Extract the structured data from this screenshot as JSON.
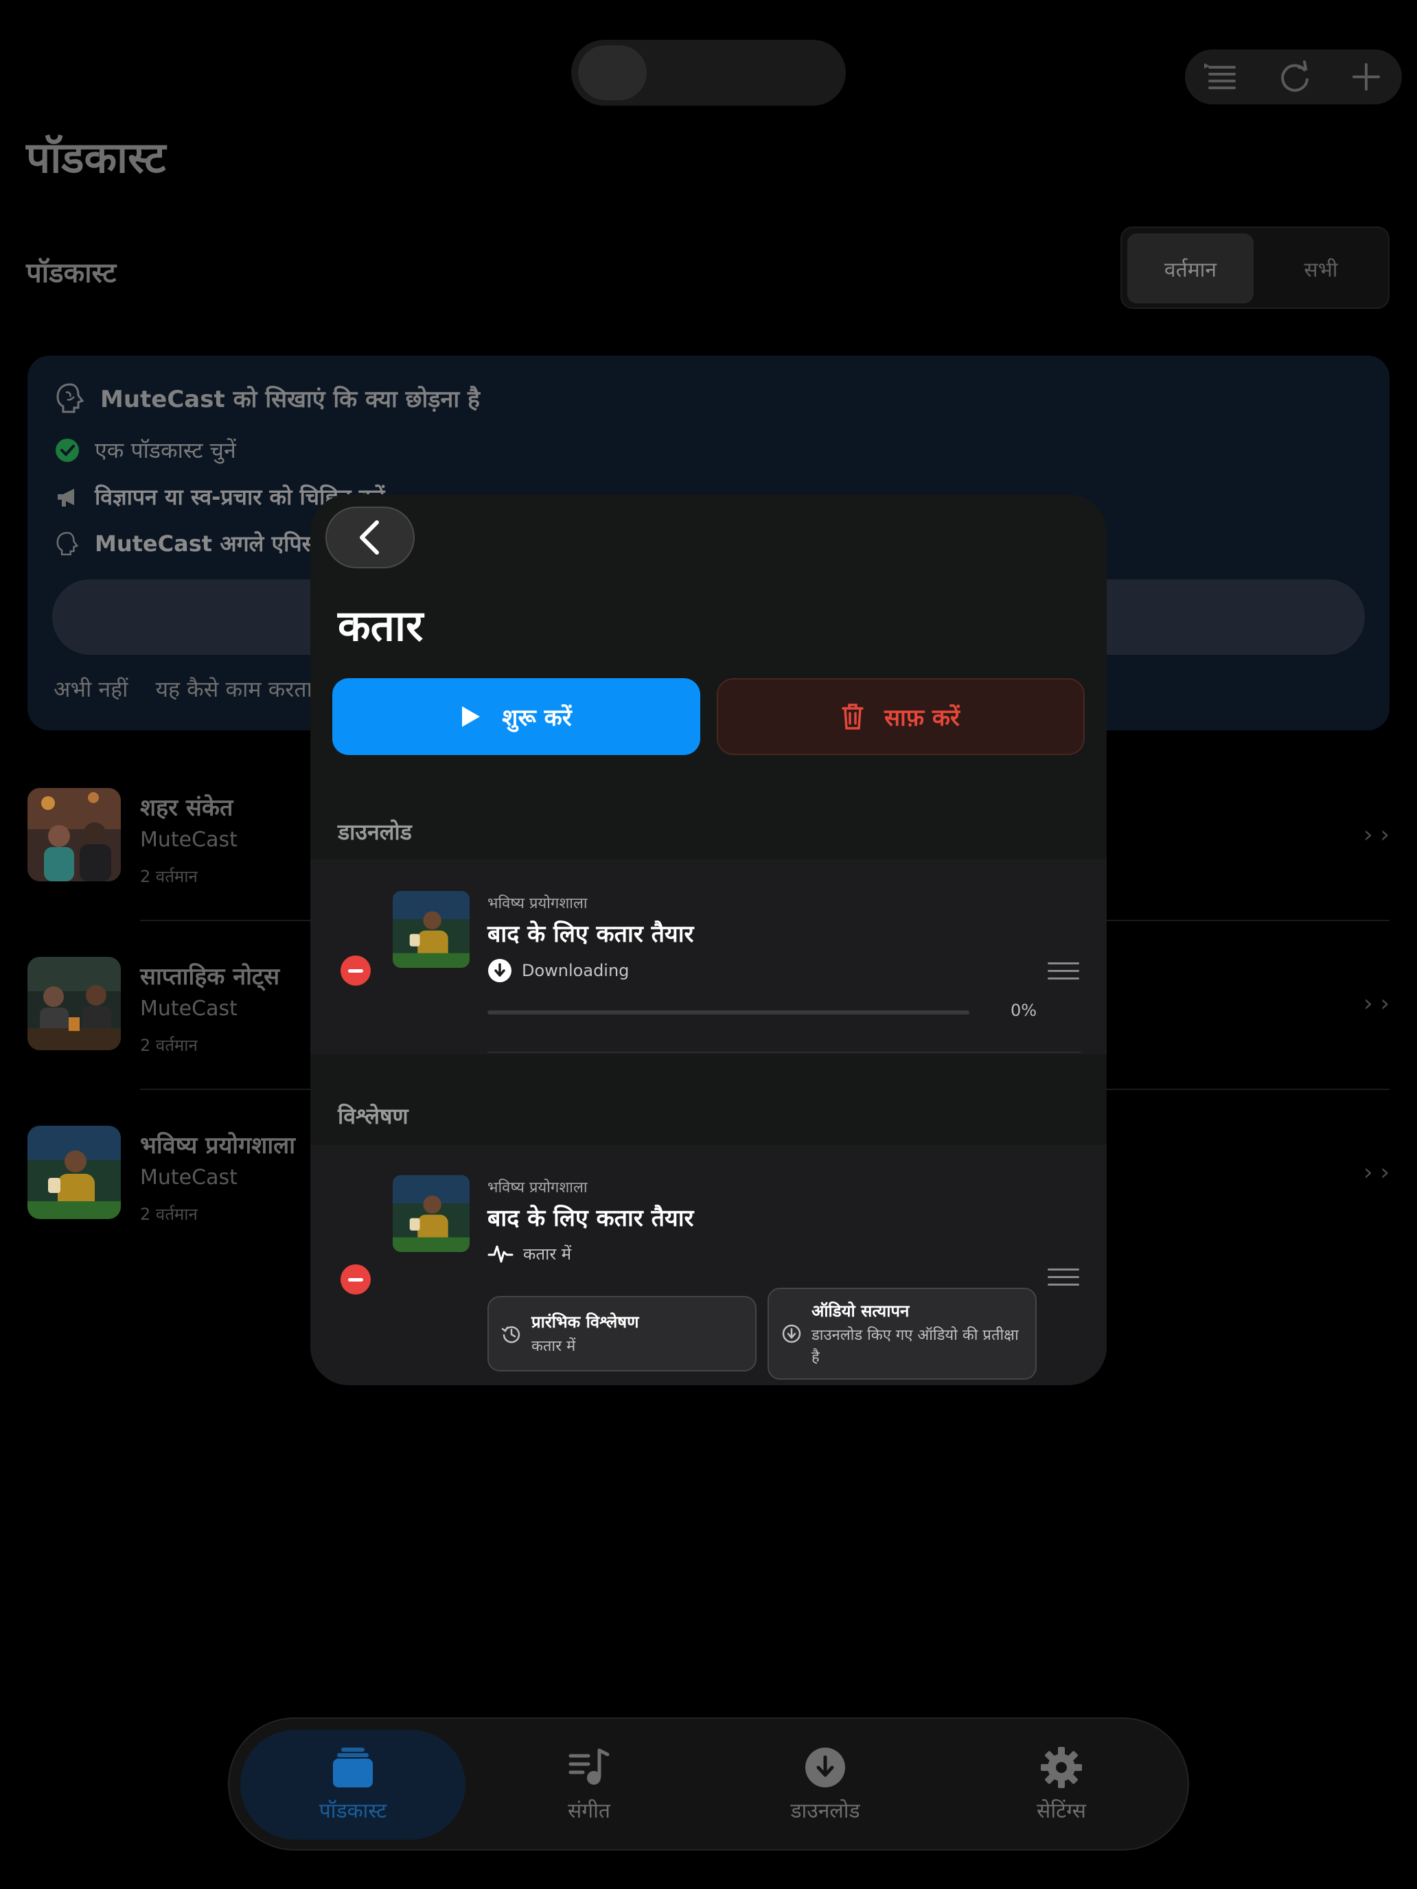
{
  "header": {
    "page_title": "पॉडकास्ट",
    "section_title": "पॉडकास्ट",
    "segment": [
      "वर्तमान",
      "सभी"
    ],
    "actions": [
      "queue-list-icon",
      "refresh-icon",
      "plus-icon"
    ]
  },
  "teach_card": {
    "title": "MuteCast को सिखाएं कि क्या छोड़ना है",
    "steps": [
      "एक पॉडकास्ट चुनें",
      "विज्ञापन या स्व-प्रचार को चिह्नित करें",
      "MuteCast अगले एपिसो"
    ],
    "links": [
      "अभी नहीं",
      "यह कैसे काम करता"
    ]
  },
  "podcasts": [
    {
      "name": "शहर संकेत",
      "publisher": "MuteCast",
      "count": "2 वर्तमान"
    },
    {
      "name": "साप्ताहिक नोट्स",
      "publisher": "MuteCast",
      "count": "2 वर्तमान"
    },
    {
      "name": "भविष्य प्रयोगशाला",
      "publisher": "MuteCast",
      "count": "2 वर्तमान"
    }
  ],
  "modal": {
    "title": "कतार",
    "start_label": "शुरू करें",
    "clear_label": "साफ़ करें",
    "downloads": {
      "section_label": "डाउनलोड",
      "item": {
        "podcast": "भविष्य प्रयोगशाला",
        "title": "बाद के लिए कतार तैयार",
        "status": "Downloading",
        "progress_percent": 0,
        "progress_label": "0%"
      }
    },
    "analysis": {
      "section_label": "विश्लेषण",
      "item": {
        "podcast": "भविष्य प्रयोगशाला",
        "title": "बाद के लिए कतार तैयार",
        "status": "कतार में",
        "chips": [
          {
            "title": "प्रारंभिक विश्लेषण",
            "subtitle": "कतार में"
          },
          {
            "title": "ऑडियो सत्यापन",
            "subtitle": "डाउनलोड किए गए ऑडियो की प्रतीक्षा है"
          }
        ]
      }
    }
  },
  "tabbar": {
    "tabs": [
      {
        "label": "पॉडकास्ट",
        "icon": "podcasts-stack-icon",
        "active": true
      },
      {
        "label": "संगीत",
        "icon": "music-list-icon",
        "active": false
      },
      {
        "label": "डाउनलोड",
        "icon": "download-circle-icon",
        "active": false
      },
      {
        "label": "सेटिंग्स",
        "icon": "gear-icon",
        "active": false
      }
    ]
  },
  "colors": {
    "accent": "#0a91f9",
    "destructive": "#e5483a",
    "remove": "#e9413d",
    "check": "#1fa84f"
  }
}
